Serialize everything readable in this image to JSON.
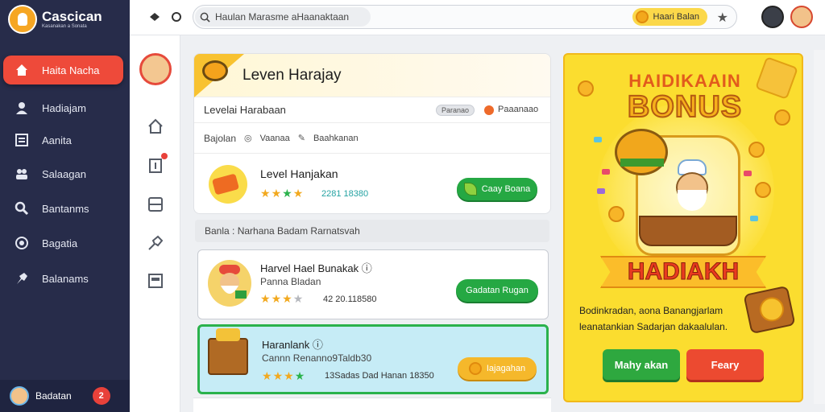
{
  "app": {
    "name": "Cascican",
    "tagline": "Kasanakan a Sonata"
  },
  "sidebar": {
    "items": [
      {
        "label": "Haita Nacha",
        "icon": "home-icon",
        "active": true
      },
      {
        "label": "Hadiajam",
        "icon": "user-icon",
        "active": false
      },
      {
        "label": "Aanita",
        "icon": "list-icon",
        "active": false
      },
      {
        "label": "Salaagan",
        "icon": "group-icon",
        "active": false
      },
      {
        "label": "Bantanms",
        "icon": "search-icon",
        "active": false
      },
      {
        "label": "Bagatia",
        "icon": "coin-icon",
        "active": false
      },
      {
        "label": "Balanams",
        "icon": "pin-icon",
        "active": false
      }
    ],
    "footer": {
      "label": "Badatan",
      "badge": "2"
    }
  },
  "topbar": {
    "search_placeholder": "Haulan Marasme aHaanaktaan",
    "pill_label": "Haari Balan"
  },
  "header_card": {
    "title": "Leven Harajay",
    "subtitle": "Levelai Harabaan",
    "chip_grey": "Paranao",
    "chip_text": "Paaanaao",
    "meta_label": "Bajolan",
    "meta_1": "Vaanaa",
    "meta_2": "Baahkanan",
    "level": {
      "title": "Level Hanjakan",
      "stars_filled": 2,
      "stars_green": 1,
      "numbers": "2281 18380",
      "button": "Caay Boana"
    }
  },
  "section_label": "Banla : Narhana Badam Rarnatsvah",
  "items": [
    {
      "title": "Harvel Hael Bunakak",
      "subtitle": "Panna Bladan",
      "stars": 3,
      "numbers": "42 20.118580",
      "button": "Gadatan Rugan",
      "highlighted": false
    },
    {
      "title": "Haranlank",
      "subtitle": "Cannn Renanno9Taldb30",
      "stars": 3,
      "numbers": "13Sadas Dad Hanan 18350",
      "button": "Iajagahan",
      "highlighted": true
    }
  ],
  "bonus": {
    "title_top": "HAIDIKAAIN",
    "title_main": "BONUS",
    "ribbon": "HADIAKH",
    "description": "Bodinkradan, aona Banangjarlam leanatankian Sadarjan dakaalulan.",
    "button_primary": "Mahy akan",
    "button_secondary": "Feary"
  },
  "colors": {
    "sidebar_bg": "#272c4a",
    "active_nav": "#ee4a3a",
    "accent_green": "#25a843",
    "bonus_bg": "#fbdd2f"
  }
}
